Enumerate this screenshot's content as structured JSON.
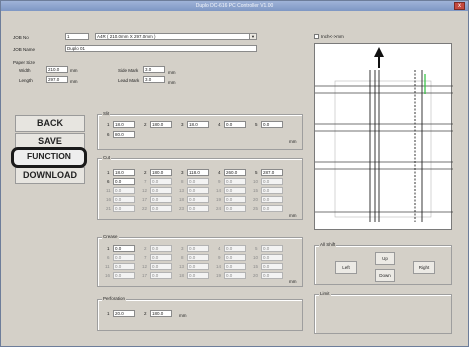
{
  "window": {
    "title": "Duplo DC-616 PC Controller V1.00",
    "close": "x"
  },
  "job": {
    "no_label": "JOB No",
    "no_value": "1",
    "paper_select": "A4R ( 210.0mm X 297.0mm )",
    "name_label": "JOB Name",
    "name_value": "Duplo 01"
  },
  "paper": {
    "heading": "Paper Size",
    "width_label": "Width",
    "width_value": "210.0",
    "length_label": "Length",
    "length_value": "297.0",
    "unit": "mm",
    "side_label": "Side Mark",
    "side_value": "3.0",
    "lead_label": "Lead Mark",
    "lead_value": "3.0"
  },
  "buttons": {
    "back": "BACK",
    "save": "SAVE",
    "function": "FUNCTION",
    "download": "DOWNLOAD"
  },
  "slit": {
    "title": "Slit",
    "row1": [
      {
        "n": "1",
        "v": "18.0"
      },
      {
        "n": "2",
        "v": "180.0"
      },
      {
        "n": "3",
        "v": "18.0"
      },
      {
        "n": "4",
        "v": "0.0"
      },
      {
        "n": "5",
        "v": "0.0"
      }
    ],
    "row2": [
      {
        "n": "6",
        "v": "80.0"
      }
    ],
    "unit": "mm"
  },
  "cut": {
    "title": "Cut",
    "active": [
      {
        "n": "1",
        "v": "18.0"
      },
      {
        "n": "2",
        "v": "180.0"
      },
      {
        "n": "3",
        "v": "118.0"
      },
      {
        "n": "4",
        "v": "260.0"
      },
      {
        "n": "5",
        "v": "287.0"
      },
      {
        "n": "6",
        "v": "0.0"
      }
    ],
    "dis1": [
      {
        "n": "7",
        "v": "0.0"
      },
      {
        "n": "8",
        "v": "0.0"
      },
      {
        "n": "9",
        "v": "0.0"
      },
      {
        "n": "10",
        "v": "0.0"
      }
    ],
    "dis2": [
      {
        "n": "11",
        "v": "0.0"
      },
      {
        "n": "12",
        "v": "0.0"
      },
      {
        "n": "13",
        "v": "0.0"
      },
      {
        "n": "14",
        "v": "0.0"
      },
      {
        "n": "15",
        "v": "0.0"
      }
    ],
    "dis3": [
      {
        "n": "16",
        "v": "0.0"
      },
      {
        "n": "17",
        "v": "0.0"
      },
      {
        "n": "18",
        "v": "0.0"
      },
      {
        "n": "19",
        "v": "0.0"
      },
      {
        "n": "20",
        "v": "0.0"
      }
    ],
    "dis4": [
      {
        "n": "21",
        "v": "0.0"
      },
      {
        "n": "22",
        "v": "0.0"
      },
      {
        "n": "23",
        "v": "0.0"
      },
      {
        "n": "24",
        "v": "0.0"
      },
      {
        "n": "25",
        "v": "0.0"
      }
    ],
    "unit": "mm"
  },
  "crease": {
    "title": "Crease",
    "rows": [
      [
        {
          "n": "1",
          "v": "0.0"
        },
        {
          "n": "2",
          "v": "0.0"
        },
        {
          "n": "3",
          "v": "0.0"
        },
        {
          "n": "4",
          "v": "0.0"
        },
        {
          "n": "5",
          "v": "0.0"
        }
      ],
      [
        {
          "n": "6",
          "v": "0.0"
        },
        {
          "n": "7",
          "v": "0.0"
        },
        {
          "n": "8",
          "v": "0.0"
        },
        {
          "n": "9",
          "v": "0.0"
        },
        {
          "n": "10",
          "v": "0.0"
        }
      ],
      [
        {
          "n": "11",
          "v": "0.0"
        },
        {
          "n": "12",
          "v": "0.0"
        },
        {
          "n": "13",
          "v": "0.0"
        },
        {
          "n": "14",
          "v": "0.0"
        },
        {
          "n": "15",
          "v": "0.0"
        }
      ],
      [
        {
          "n": "16",
          "v": "0.0"
        },
        {
          "n": "17",
          "v": "0.0"
        },
        {
          "n": "18",
          "v": "0.0"
        },
        {
          "n": "19",
          "v": "0.0"
        },
        {
          "n": "20",
          "v": "0.0"
        }
      ]
    ],
    "unit": "mm"
  },
  "perforation": {
    "title": "Perforation",
    "fields": [
      {
        "n": "1",
        "v": "20.0"
      },
      {
        "n": "2",
        "v": "180.0"
      }
    ],
    "unit": "mm"
  },
  "inch": {
    "label": "Inch<->mm"
  },
  "shift": {
    "title": "All Shift",
    "up": "Up",
    "down": "Down",
    "left": "Left",
    "right": "Right"
  },
  "limit": {
    "title": "Limit"
  }
}
